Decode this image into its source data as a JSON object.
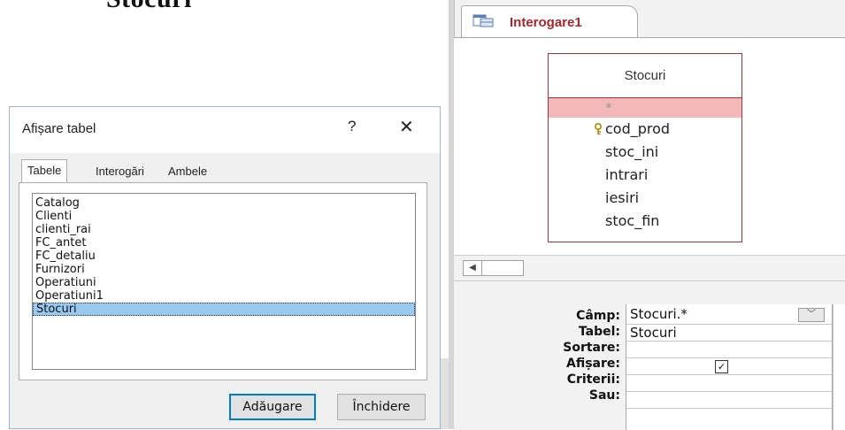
{
  "heading": "Stocuri",
  "dialog": {
    "title": "Afișare tabel",
    "help": "?",
    "close": "✕",
    "tabs": [
      "Tabele",
      "Interogări",
      "Ambele"
    ],
    "tables": [
      "Catalog",
      "Clienti",
      "clienti_rai",
      "FC_antet",
      "FC_detaliu",
      "Furnizori",
      "Operatiuni",
      "Operatiuni1",
      "Stocuri"
    ],
    "selected": "Stocuri",
    "add_button": "Adăugare",
    "close_button": "Închidere"
  },
  "query": {
    "tab_label": "Interogare1",
    "field_list": {
      "title": "Stocuri",
      "star": "*",
      "fields": [
        "cod_prod",
        "stoc_ini",
        "intrari",
        "iesiri",
        "stoc_fin"
      ]
    },
    "grid": {
      "row_labels": [
        "Câmp:",
        "Tabel:",
        "Sortare:",
        "Afișare:",
        "Criterii:",
        "Sau:"
      ],
      "field": "Stocuri.*",
      "table": "Stocuri",
      "show_checked": "✓"
    }
  }
}
